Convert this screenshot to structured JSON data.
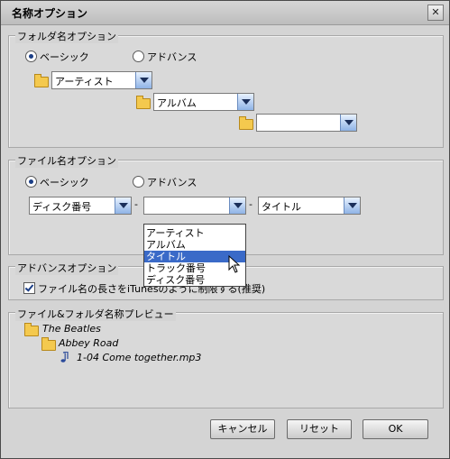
{
  "window": {
    "title": "名称オプション",
    "close": "✕"
  },
  "folder_group": {
    "legend": "フォルダ名オプション",
    "basic": "ベーシック",
    "advanced": "アドバンス",
    "combo1": "アーティスト",
    "combo2": "アルバム",
    "combo3": ""
  },
  "file_group": {
    "legend": "ファイル名オプション",
    "basic": "ベーシック",
    "advanced": "アドバンス",
    "combo1": "ディスク番号",
    "combo2": "",
    "combo3": "タイトル",
    "sep": "-",
    "dropdown_options": [
      "アーティスト",
      "アルバム",
      "タイトル",
      "トラック番号",
      "ディスク番号"
    ]
  },
  "advanced_group": {
    "legend": "アドバンスオプション",
    "checkbox_label": "ファイル名の長さをiTunesのように制限する(推奨)"
  },
  "preview_group": {
    "legend": "ファイル&フォルダ名称プレビュー",
    "artist": "The Beatles",
    "album": "Abbey Road",
    "file": "1-04 Come together.mp3"
  },
  "buttons": {
    "cancel": "キャンセル",
    "reset": "リセット",
    "ok": "OK"
  }
}
